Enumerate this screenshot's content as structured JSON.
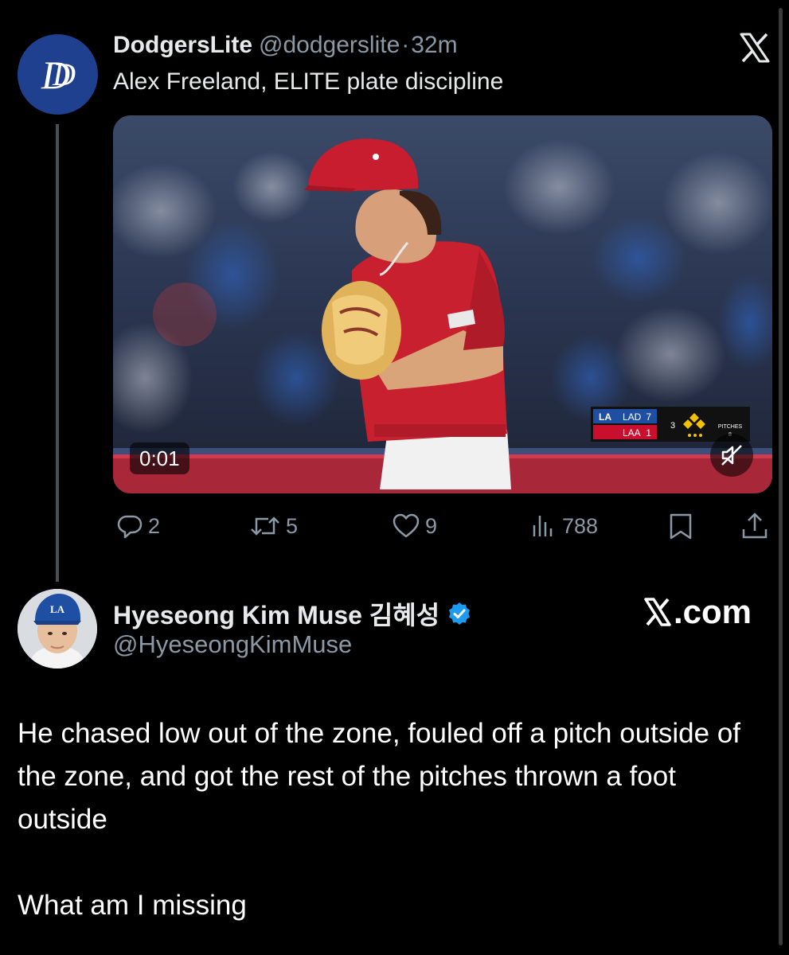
{
  "quoted_tweet": {
    "avatar_letters": "D",
    "display_name": "DodgersLite",
    "handle": "@dodgerslite",
    "separator": "·",
    "time": "32m",
    "text": "Alex Freeland, ELITE plate discipline",
    "video": {
      "duration": "0:01",
      "scorebug": {
        "team1": "LAD",
        "score1": "7",
        "team2": "LAA",
        "score2": "1",
        "inning": "3",
        "pitches_label": "PITCHES",
        "pitches_value": "8"
      }
    },
    "actions": {
      "replies": "2",
      "reposts": "5",
      "likes": "9",
      "views": "788"
    }
  },
  "reply": {
    "display_name": "Hyeseong Kim Muse 김혜성",
    "handle": "@HyeseongKimMuse",
    "brand": ".com",
    "paragraphs": [
      "He chased low out of the zone, fouled off a pitch outside of the zone, and got the rest of the pitches thrown a foot outside",
      "What am I missing"
    ]
  },
  "colors": {
    "background": "#000000",
    "secondary_text": "#8b98a5",
    "verified": "#1d9bf0",
    "angels_red": "#c8102e"
  }
}
